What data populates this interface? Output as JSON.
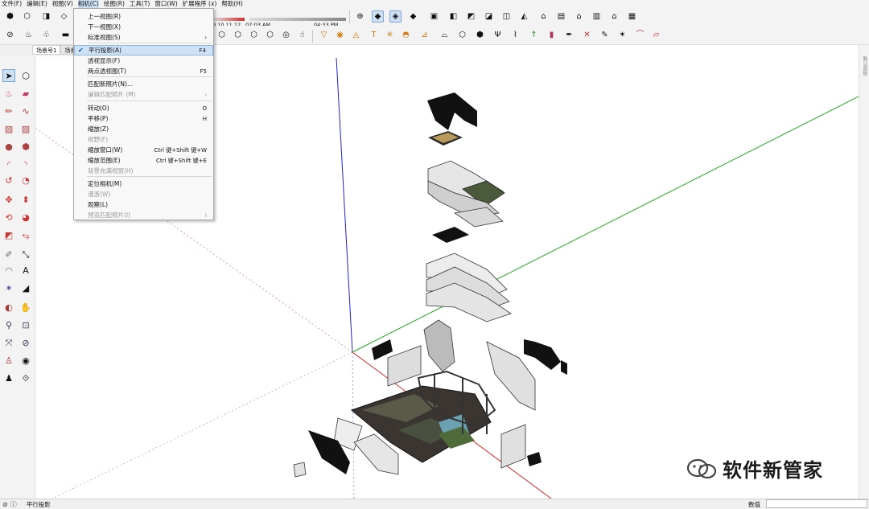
{
  "menubar": [
    "文件(F)",
    "编辑(E)",
    "视图(V)",
    "相机(C)",
    "绘图(R)",
    "工具(T)",
    "窗口(W)",
    "扩展程序 (x)",
    "帮助(H)"
  ],
  "camera_menu": {
    "items": [
      {
        "label": "上一视图(R)",
        "shortcut": "",
        "disabled": false
      },
      {
        "label": "下一视图(X)",
        "shortcut": "",
        "disabled": false
      },
      {
        "label": "标准视图(S)",
        "shortcut": "›",
        "disabled": false
      },
      {
        "label": "平行投影(A)",
        "shortcut": "F4",
        "disabled": false,
        "checked": true,
        "highlighted": true
      },
      {
        "label": "透视显示(F)",
        "shortcut": "",
        "disabled": false
      },
      {
        "label": "两点透视图(T)",
        "shortcut": "F5",
        "disabled": false
      },
      {
        "label": "匹配新照片(N)...",
        "shortcut": "",
        "disabled": false
      },
      {
        "label": "编辑匹配照片 (M)",
        "shortcut": "›",
        "disabled": true
      },
      {
        "label": "转动(O)",
        "shortcut": "O",
        "disabled": false
      },
      {
        "label": "平移(P)",
        "shortcut": "H",
        "disabled": false
      },
      {
        "label": "缩放(Z)",
        "shortcut": "",
        "disabled": false
      },
      {
        "label": "视野(F)",
        "shortcut": "",
        "disabled": true
      },
      {
        "label": "缩放窗口(W)",
        "shortcut": "Ctrl 键+Shift 键+W",
        "disabled": false
      },
      {
        "label": "缩放范围(E)",
        "shortcut": "Ctrl 键+Shift 键+E",
        "disabled": false
      },
      {
        "label": "背景充满视窗(H)",
        "shortcut": "",
        "disabled": true
      },
      {
        "label": "定位相机(M)",
        "shortcut": "",
        "disabled": false
      },
      {
        "label": "漫游(W)",
        "shortcut": "",
        "disabled": true
      },
      {
        "label": "观察(L)",
        "shortcut": "",
        "disabled": false
      },
      {
        "label": "预览匹配照片(I)",
        "shortcut": "I",
        "disabled": true
      }
    ]
  },
  "shadow": {
    "months": "9 10 11 12",
    "start_time": "07:03 AM",
    "end_time": "04:33 PM"
  },
  "scene_tabs": [
    "场景号1",
    "场景号"
  ],
  "right_panel_label": "默认面板",
  "status": {
    "text": "平行投影",
    "measure_label": "数值",
    "measure_value": ""
  },
  "watermark": "软件新管家",
  "colors": {
    "red_axis": "#d22",
    "green_axis": "#2a2",
    "blue_axis": "#22c",
    "highlight": "#cde2f7"
  }
}
